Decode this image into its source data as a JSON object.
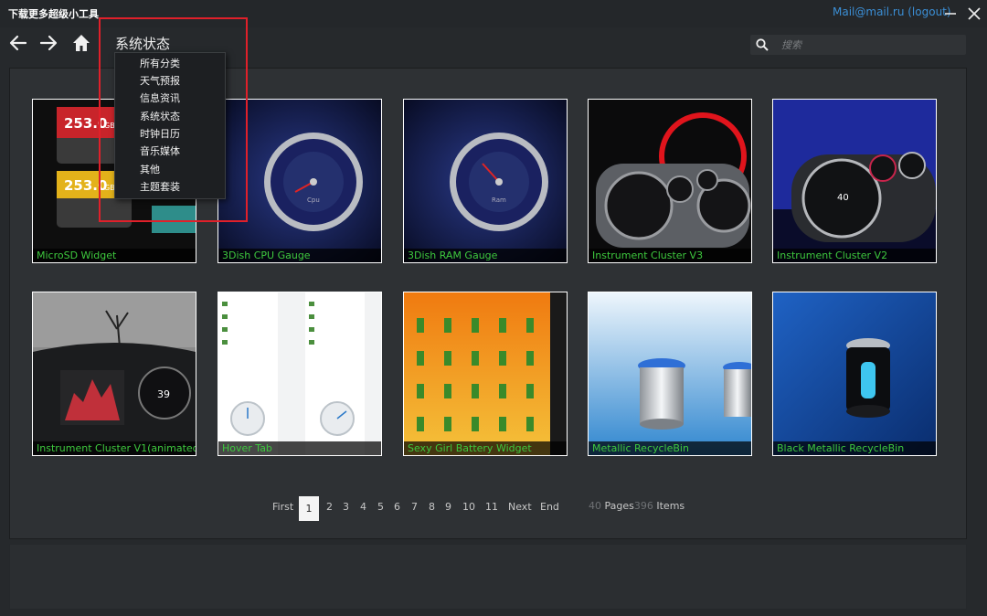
{
  "app": {
    "title": "下载更多超级小工具",
    "account": "Mail@mail.ru (logout)"
  },
  "nav": {
    "category": "系统状态"
  },
  "search": {
    "placeholder": "搜索"
  },
  "menu": {
    "items": [
      "所有分类",
      "天气预报",
      "信息资讯",
      "系统状态",
      "时钟日历",
      "音乐媒体",
      "其他",
      "主题套装"
    ]
  },
  "gallery": {
    "tiles": [
      {
        "label": "MicroSD Widget"
      },
      {
        "label": "3Dish CPU Gauge"
      },
      {
        "label": "3Dish RAM Gauge"
      },
      {
        "label": "Instrument Cluster V3"
      },
      {
        "label": "Instrument Cluster V2"
      },
      {
        "label": "Instrument Cluster V1(animated"
      },
      {
        "label": "Hover Tab"
      },
      {
        "label": "Sexy Girl Battery Widget"
      },
      {
        "label": "Metallic RecycleBin"
      },
      {
        "label": "Black Metallic RecycleBin"
      }
    ],
    "thumb_text": {
      "sd1": "253.0",
      "sd2": "253.0",
      "sd_unit": "GB",
      "cpu": "Cpu",
      "ram": "Ram",
      "speed": "40",
      "v1_speed": "39"
    }
  },
  "pager": {
    "first": "First",
    "current": "1",
    "pages": [
      "2",
      "3",
      "4",
      "5",
      "6",
      "7",
      "8",
      "9",
      "10",
      "11"
    ],
    "next": "Next",
    "end": "End",
    "page_count": "40",
    "pages_label": "Pages",
    "item_count": "396",
    "items_label": "Items"
  },
  "colors": {
    "accent_link": "#3b8fd6",
    "label_green": "#3ec93e",
    "highlight_red": "#e0202a"
  }
}
